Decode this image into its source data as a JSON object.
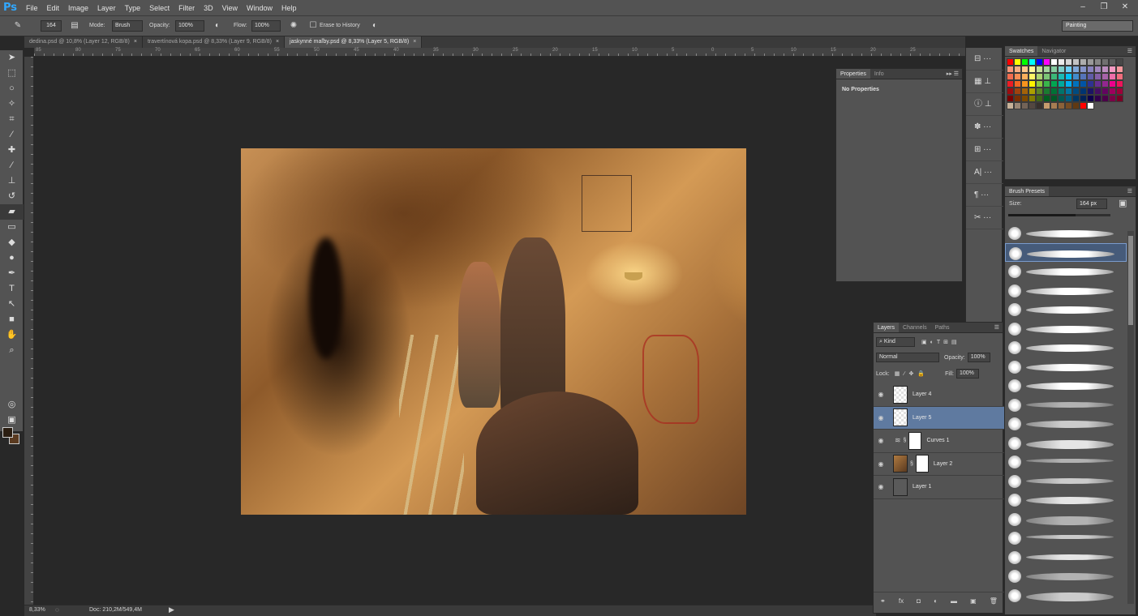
{
  "app": {
    "logo": "Ps"
  },
  "menu": [
    "File",
    "Edit",
    "Image",
    "Layer",
    "Type",
    "Select",
    "Filter",
    "3D",
    "View",
    "Window",
    "Help"
  ],
  "window_controls": [
    "–",
    "❐",
    "✕"
  ],
  "options": {
    "brush_size": "164",
    "mode_label": "Mode:",
    "mode_value": "Brush",
    "opacity_label": "Opacity:",
    "opacity_value": "100%",
    "flow_label": "Flow:",
    "flow_value": "100%",
    "erase_history": "Erase to History",
    "workspace": "Painting"
  },
  "tabs": [
    {
      "label": "dedina.psd @ 10,8% (Layer 12, RGB/8)",
      "active": false
    },
    {
      "label": "travertínová kopa.psd @ 8,33% (Layer 9, RGB/8)",
      "active": false
    },
    {
      "label": "jaskynné maľby.psd @ 8,33% (Layer 5, RGB/8)",
      "active": true
    }
  ],
  "ruler_numbers": [
    "85",
    "80",
    "75",
    "70",
    "65",
    "60",
    "55",
    "50",
    "45",
    "40",
    "35",
    "30",
    "25",
    "20",
    "15",
    "10",
    "5",
    "0",
    "5",
    "10",
    "15",
    "20",
    "25"
  ],
  "status": {
    "zoom": "8,33%",
    "doc": "Doc: 210,2M/549,4M"
  },
  "properties": {
    "tabs": [
      "Properties",
      "Info"
    ],
    "content": "No Properties"
  },
  "swatches": {
    "tabs": [
      "Swatches",
      "Navigator"
    ],
    "colors": [
      "#ff0000",
      "#ffff00",
      "#00ff00",
      "#00ffff",
      "#0000ff",
      "#ff00ff",
      "#ffffff",
      "#ebebeb",
      "#d6d6d6",
      "#c2c2c2",
      "#adadad",
      "#999999",
      "#858585",
      "#707070",
      "#5c5c5c",
      "#474747",
      "#f7977a",
      "#f9ad81",
      "#fdc68a",
      "#fff79a",
      "#c4df9b",
      "#a3d39c",
      "#82ca9d",
      "#7bcdc8",
      "#6ecff6",
      "#7ea7d8",
      "#8493ca",
      "#8882be",
      "#a187be",
      "#bc8dbf",
      "#f49ac2",
      "#f6989d",
      "#f26c4f",
      "#f68e55",
      "#fbaf5c",
      "#fff467",
      "#acd372",
      "#7cc576",
      "#3bb878",
      "#1abbb4",
      "#00bff3",
      "#438ccb",
      "#5574b9",
      "#605ca8",
      "#855fa8",
      "#a763a8",
      "#f06ea9",
      "#f26d7d",
      "#ed1c24",
      "#f26522",
      "#f7941d",
      "#fff200",
      "#8dc73f",
      "#39b54a",
      "#00a651",
      "#00a99d",
      "#00aeef",
      "#0072bc",
      "#0054a6",
      "#2e3192",
      "#662d91",
      "#92278f",
      "#ec008c",
      "#ed145b",
      "#9e0b0f",
      "#a0410d",
      "#a36209",
      "#aba000",
      "#598527",
      "#1a7b30",
      "#007236",
      "#00746b",
      "#0076a3",
      "#004b80",
      "#003471",
      "#1b1464",
      "#440e62",
      "#630460",
      "#9e005d",
      "#9e0039",
      "#790000",
      "#7b2e00",
      "#7d4900",
      "#827b00",
      "#406618",
      "#005e20",
      "#005826",
      "#005952",
      "#005b7f",
      "#003663",
      "#002157",
      "#0d004c",
      "#32004b",
      "#4b0049",
      "#7b0046",
      "#7a0026",
      "#c7b299",
      "#998675",
      "#736357",
      "#534741",
      "#37302d",
      "#c69c6d",
      "#a67c52",
      "#8c6239",
      "#754c24",
      "#603913",
      "#ff0000",
      "#ffffff"
    ]
  },
  "brush_presets": {
    "tab": "Brush Presets",
    "size_label": "Size:",
    "size_value": "164 px",
    "slider_fraction": 0.66
  },
  "layers": {
    "tabs": [
      "Layers",
      "Channels",
      "Paths"
    ],
    "filter": "Kind",
    "blend_mode": "Normal",
    "opacity_label": "Opacity:",
    "opacity_value": "100%",
    "lock_label": "Lock:",
    "fill_label": "Fill:",
    "fill_value": "100%",
    "items": [
      {
        "name": "Layer 4",
        "selected": false
      },
      {
        "name": "Layer 5",
        "selected": true
      },
      {
        "name": "Curves 1",
        "selected": false
      },
      {
        "name": "Layer 2",
        "selected": false
      },
      {
        "name": "Layer 1",
        "selected": false
      }
    ]
  }
}
